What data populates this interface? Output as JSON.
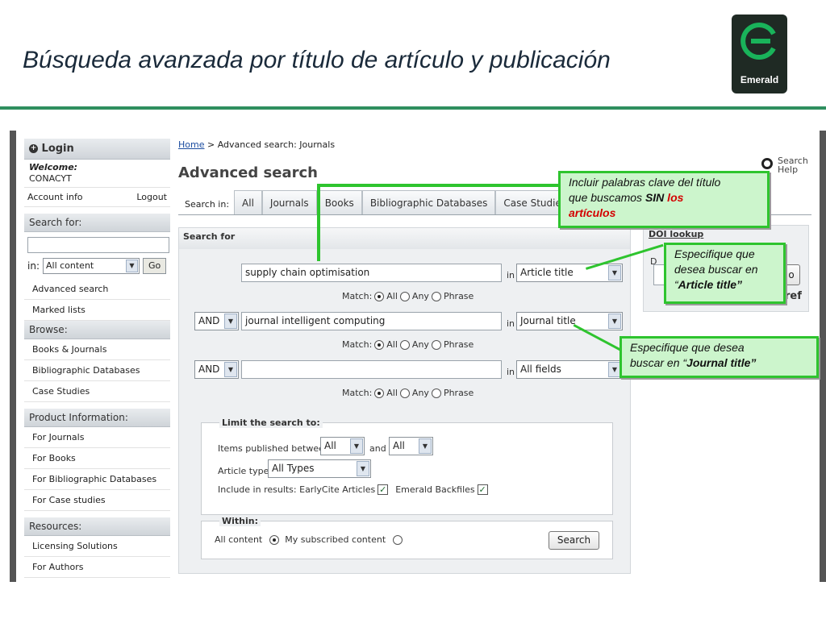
{
  "slide": {
    "title": "Búsqueda avanzada por título de artículo y publicación",
    "logo_text": "Emerald"
  },
  "sidebar": {
    "login_label": "Login",
    "welcome_label": "Welcome:",
    "user_name": "CONACYT",
    "account_info": "Account info",
    "logout": "Logout",
    "search_for_label": "Search for:",
    "in_label": "in:",
    "scope_selected": "All content",
    "go_label": "Go",
    "search_links": [
      "Advanced search",
      "Marked lists"
    ],
    "browse_label": "Browse:",
    "browse_items": [
      "Books & Journals",
      "Bibliographic Databases",
      "Case Studies"
    ],
    "product_label": "Product Information:",
    "product_items": [
      "For Journals",
      "For Books",
      "For Bibliographic Databases",
      "For Case studies"
    ],
    "resources_label": "Resources:",
    "resources_items": [
      "Licensing Solutions",
      "For Authors"
    ]
  },
  "breadcrumb": {
    "home": "Home",
    "separator": " > ",
    "current": "Advanced search: Journals"
  },
  "page_title": "Advanced search",
  "help": {
    "line1": "Search",
    "line2": "Help"
  },
  "tabs": {
    "label": "Search in:",
    "items": [
      "All",
      "Journals",
      "Books",
      "Bibliographic Databases",
      "Case Studies"
    ]
  },
  "search_panel": {
    "header": "Search for",
    "in_word": "in",
    "match_label": "Match:",
    "match_options": [
      "All",
      "Any",
      "Phrase"
    ],
    "rows": [
      {
        "operator": "",
        "query": "supply chain optimisation",
        "field": "Article title"
      },
      {
        "operator": "AND",
        "query": "journal intelligent computing",
        "field": "Journal title"
      },
      {
        "operator": "AND",
        "query": "",
        "field": "All fields"
      }
    ]
  },
  "limit": {
    "legend": "Limit the search to:",
    "published_label": "Items published between:",
    "from_value": "All",
    "and_label": "and",
    "to_value": "All",
    "article_type_label": "Article type:",
    "article_type_value": "All Types",
    "include_label": "Include in results: EarlyCite Articles",
    "backfiles_label": "Emerald Backfiles"
  },
  "within": {
    "legend": "Within:",
    "all_content": "All content",
    "subscribed": "My subscribed content"
  },
  "search_button": "Search",
  "doi": {
    "header": "DOI lookup",
    "partial_text": "ref",
    "partial_button": "o",
    "partial_char": "D"
  },
  "callouts": {
    "keywords": {
      "line1": "Incluir palabras clave del título",
      "line2_prefix": "que buscamos ",
      "line2_bold": "SIN",
      "line2_red": " los",
      "line3_red": "artículos"
    },
    "article": {
      "line1": "Especifique que",
      "line2": "desea buscar en",
      "line3_prefix": "“",
      "line3_bold": "Article title”"
    },
    "journal": {
      "line1": "Especifique que desea",
      "line2_prefix": "buscar en “",
      "line2_bold": "Journal title”"
    }
  },
  "colors": {
    "accent_green": "#2ec42e",
    "callout_fill": "#ccf5cc",
    "header_rule": "#2f8f5f",
    "highlight_red": "#d40000"
  }
}
